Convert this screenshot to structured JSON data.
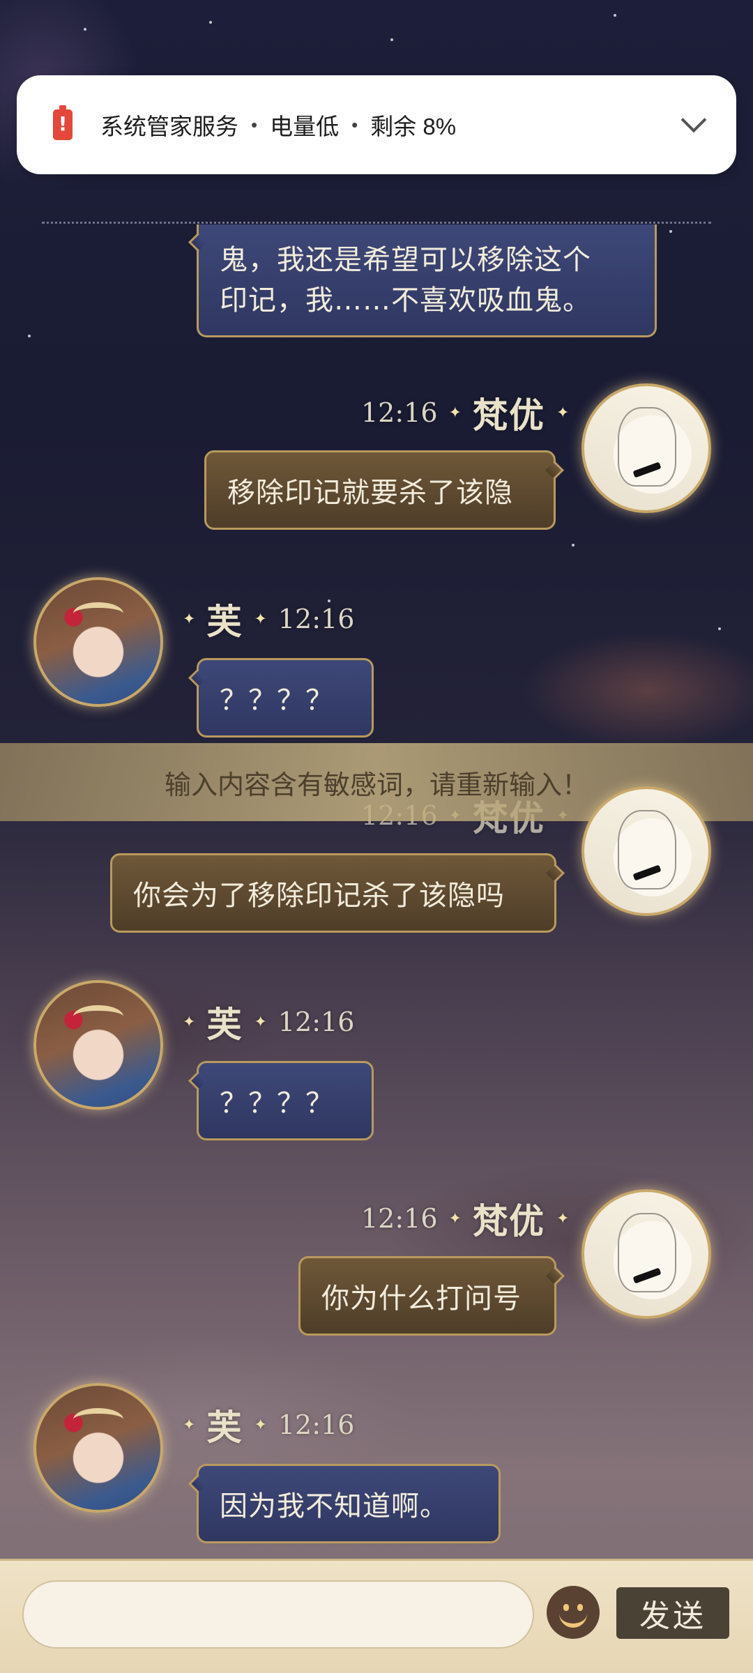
{
  "notification": {
    "battery_glyph": "!",
    "app": "系统管家服务",
    "sep1": "•",
    "title": "电量低",
    "sep2": "•",
    "detail": "剩余 8%"
  },
  "chat": {
    "partial_message_line1": "鬼，我还是希望可以移除这个",
    "partial_message_line2": "印记，我……不喜欢吸血鬼。",
    "messages": [
      {
        "sender": "梵优",
        "time": "12:16",
        "text": "移除印记就要杀了该隐"
      },
      {
        "sender": "芙",
        "time": "12:16",
        "text": "？？？？"
      },
      {
        "sender": "梵优",
        "time": "12:16",
        "text": "你会为了移除印记杀了该隐吗"
      },
      {
        "sender": "芙",
        "time": "12:16",
        "text": "？？？？"
      },
      {
        "sender": "梵优",
        "time": "12:16",
        "text": "你为什么打问号"
      },
      {
        "sender": "芙",
        "time": "12:16",
        "text": "因为我不知道啊。"
      }
    ],
    "spark": "✦"
  },
  "toast": {
    "text": "输入内容含有敏感词，请重新输入！"
  },
  "input": {
    "send_label": "发送",
    "value": ""
  },
  "colors": {
    "blue_bubble": "#3e4878",
    "brown_bubble": "#6f5839",
    "gold_border": "#b99a5e",
    "battery_red": "#e4483b"
  }
}
